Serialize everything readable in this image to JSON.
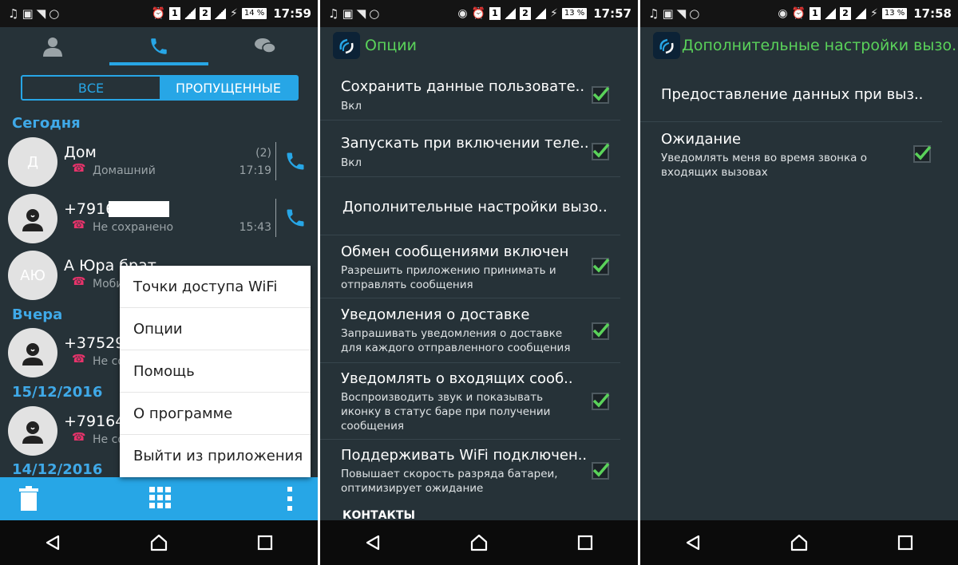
{
  "screen1": {
    "status_time": "17:59",
    "battery": "14 %",
    "filter": {
      "all": "ВСЕ",
      "missed": "ПРОПУЩЕННЫЕ"
    },
    "sections": {
      "today": "Сегодня",
      "yesterday": "Вчера",
      "date1": "15/12/2016",
      "date2": "14/12/2016"
    },
    "calls": [
      {
        "avatar": "Д",
        "name": "Дом",
        "type": "Домашний",
        "count": "(2)",
        "time": "17:19"
      },
      {
        "avatar": "",
        "name": "+7916",
        "type": "Не сохранено",
        "time": "15:43"
      },
      {
        "avatar": "АЮ",
        "name": "А Юра брат",
        "type": "Мобильный"
      },
      {
        "avatar": "",
        "name": "+375296",
        "type": "Не сохранено"
      },
      {
        "avatar": "",
        "name": "+791640",
        "type": "Не сохранено"
      }
    ],
    "menu": [
      "Точки доступа WiFi",
      "Опции",
      "Помощь",
      "О программе",
      "Выйти из приложения"
    ]
  },
  "screen2": {
    "status_time": "17:57",
    "battery": "13 %",
    "title": "Опции",
    "prefs": [
      {
        "title": "Сохранить данные пользовате..",
        "summary": "Вкл",
        "checked": true
      },
      {
        "title": "Запускать при включении теле..",
        "summary": "Вкл",
        "checked": true
      },
      {
        "title": "Дополнительные настройки вызо..",
        "summary": "",
        "checked": false
      },
      {
        "title": "Обмен сообщениями включен",
        "summary": "Разрешить приложению принимать и отправлять сообщения",
        "checked": true
      },
      {
        "title": "Уведомления о доставке",
        "summary": "Запрашивать уведомления о доставке для каждого отправленного сообщения",
        "checked": true
      },
      {
        "title": "Уведомлять о входящих сооб..",
        "summary": "Воспроизводить звук и показывать иконку в статус баре при получении сообщения",
        "checked": true
      },
      {
        "title": "Поддерживать WiFi подключен..",
        "summary": "Повышает скорость разряда батареи, оптимизирует ожидание",
        "checked": true
      }
    ],
    "category": "КОНТАКТЫ"
  },
  "screen3": {
    "status_time": "17:58",
    "battery": "13 %",
    "title": "Дополнительные настройки вызо...",
    "prefs": [
      {
        "title": "Предоставление данных при выз..",
        "summary": ""
      },
      {
        "title": "Ожидание",
        "summary": "Уведомлять меня во время звонка о входящих вызовах",
        "checked": true
      }
    ]
  },
  "colors": {
    "accent": "#27a6e6",
    "green": "#5ad25a",
    "missed": "#e8336b",
    "bg": "#263238"
  },
  "icons": [
    "music-icon",
    "image-icon",
    "wifi-icon",
    "circle-icon",
    "location-icon",
    "alarm-icon",
    "signal-icon",
    "battery-icon",
    "contacts-icon",
    "phone-icon",
    "chat-icon",
    "missed-call-icon",
    "trash-icon",
    "dialpad-icon",
    "more-icon",
    "back-icon",
    "home-icon",
    "recents-icon"
  ]
}
